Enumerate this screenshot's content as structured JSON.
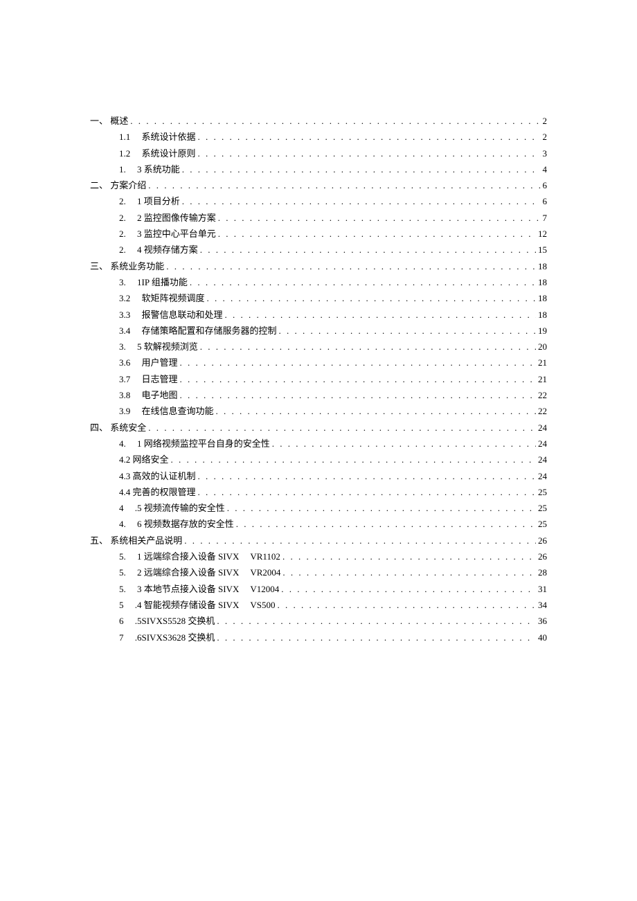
{
  "toc": [
    {
      "level": 0,
      "label": "一、 概述",
      "page": "2"
    },
    {
      "level": 1,
      "label": "1.1　 系统设计依据",
      "page": "2"
    },
    {
      "level": 1,
      "label": "1.2　 系统设计原则",
      "page": "3"
    },
    {
      "level": 1,
      "label": "1.　 3 系统功能",
      "page": "4"
    },
    {
      "level": 0,
      "label": "二、 方案介绍",
      "page": "6"
    },
    {
      "level": 1,
      "label": "2.　 1 项目分析",
      "page": "6"
    },
    {
      "level": 1,
      "label": "2.　 2 监控图像传输方案",
      "page": "7"
    },
    {
      "level": 1,
      "label": "2.　 3 监控中心平台单元",
      "page": "12"
    },
    {
      "level": 1,
      "label": "2.　 4 视频存储方案",
      "page": "15"
    },
    {
      "level": 0,
      "label": "三、 系统业务功能",
      "page": "18"
    },
    {
      "level": 1,
      "label": "3.　 1IP 组播功能",
      "page": "18"
    },
    {
      "level": 1,
      "label": "3.2　 软矩阵视频调度",
      "page": "18"
    },
    {
      "level": 1,
      "label": "3.3　 报警信息联动和处理",
      "page": "18"
    },
    {
      "level": 1,
      "label": "3.4　 存储策略配置和存储服务器的控制",
      "page": "19"
    },
    {
      "level": 1,
      "label": "3.　 5 软解视频浏览",
      "page": "20"
    },
    {
      "level": 1,
      "label": "3.6　 用户管理",
      "page": "21"
    },
    {
      "level": 1,
      "label": "3.7　 日志管理",
      "page": "21"
    },
    {
      "level": 1,
      "label": "3.8　 电子地图",
      "page": "22"
    },
    {
      "level": 1,
      "label": "3.9　 在线信息查询功能",
      "page": "22"
    },
    {
      "level": 0,
      "label": "四、 系统安全",
      "page": "24"
    },
    {
      "level": 1,
      "label": "4.　 1 网络视频监控平台自身的安全性",
      "page": "24"
    },
    {
      "level": 1,
      "label": "4.2 网络安全",
      "page": "24"
    },
    {
      "level": 1,
      "label": "4.3 高效的认证机制",
      "page": "24"
    },
    {
      "level": 1,
      "label": "4.4 完善的权限管理",
      "page": "25"
    },
    {
      "level": 1,
      "label": "4　 .5 视频流传输的安全性",
      "page": "25"
    },
    {
      "level": 1,
      "label": "4.　 6 视频数据存放的安全性",
      "page": "25"
    },
    {
      "level": 0,
      "label": "五、 系统相关产品说明",
      "page": "26"
    },
    {
      "level": 1,
      "label": "5.　 1 远端综合接入设备 SIVX　 VR1102",
      "page": "26"
    },
    {
      "level": 1,
      "label": "5.　 2 远端综合接入设备 SIVX　 VR2004",
      "page": "28"
    },
    {
      "level": 1,
      "label": "5.　 3 本地节点接入设备 SIVX　 V12004",
      "page": "31"
    },
    {
      "level": 1,
      "label": "5　 .4 智能视频存储设备 SIVX　 VS500",
      "page": "34"
    },
    {
      "level": 1,
      "label": "6　 .5SIVXS5528 交换机",
      "page": "36"
    },
    {
      "level": 1,
      "label": "7　 .6SIVXS3628 交换机",
      "page": "40"
    }
  ]
}
